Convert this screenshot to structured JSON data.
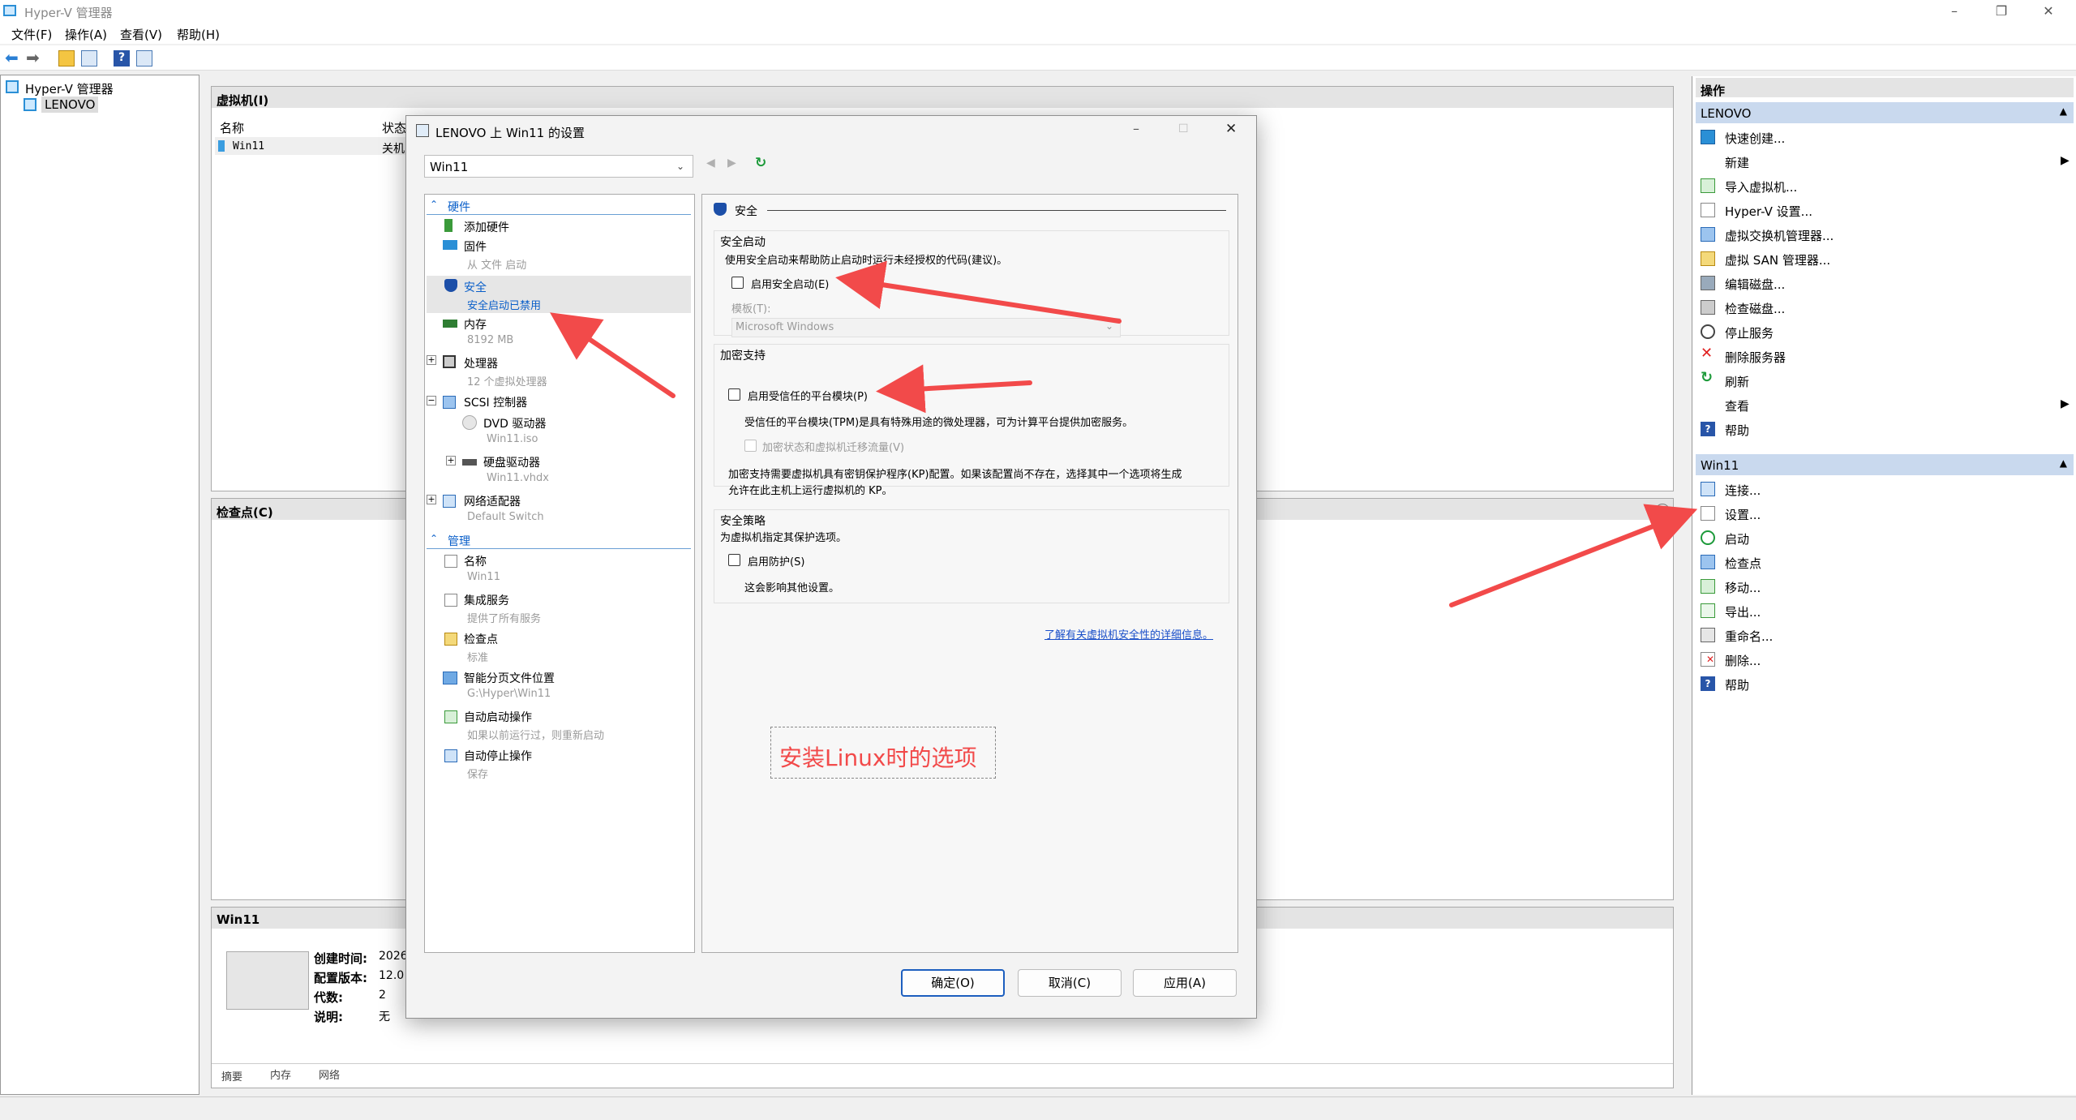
{
  "app": {
    "title": "Hyper-V 管理器"
  },
  "menu": [
    "文件(F)",
    "操作(A)",
    "查看(V)",
    "帮助(H)"
  ],
  "tree": {
    "root": "Hyper-V 管理器",
    "host": "LENOVO"
  },
  "vm_panel": {
    "title": "虚拟机(I)",
    "col_name": "名称",
    "col_state": "状态",
    "row_name": "Win11",
    "row_state": "关机"
  },
  "checkpoint_panel": {
    "title": "检查点(C)"
  },
  "details_panel": {
    "title": "Win11",
    "rows": [
      {
        "label": "创建时间:",
        "value": "2026"
      },
      {
        "label": "配置版本:",
        "value": "12.0"
      },
      {
        "label": "代数:",
        "value": "2"
      },
      {
        "label": "说明:",
        "value": "无"
      }
    ],
    "tabs": [
      "摘要",
      "内存",
      "网络"
    ]
  },
  "actions": {
    "title": "操作",
    "group1": "LENOVO",
    "items1": [
      "快速创建...",
      "新建",
      "导入虚拟机...",
      "Hyper-V 设置...",
      "虚拟交换机管理器...",
      "虚拟 SAN 管理器...",
      "编辑磁盘...",
      "检查磁盘...",
      "停止服务",
      "删除服务器",
      "刷新",
      "查看",
      "帮助"
    ],
    "group2": "Win11",
    "items2": [
      "连接...",
      "设置...",
      "启动",
      "检查点",
      "移动...",
      "导出...",
      "重命名...",
      "删除...",
      "帮助"
    ]
  },
  "dialog": {
    "title": "LENOVO 上 Win11 的设置",
    "vm_select": "Win11",
    "hardware_header": "硬件",
    "hardware": [
      {
        "name": "添加硬件",
        "sub": ""
      },
      {
        "name": "固件",
        "sub": "从 文件 启动"
      },
      {
        "name": "安全",
        "sub": "安全启动已禁用"
      },
      {
        "name": "内存",
        "sub": "8192 MB"
      },
      {
        "name": "处理器",
        "sub": "12 个虚拟处理器"
      },
      {
        "name": "SCSI 控制器",
        "sub": ""
      },
      {
        "name": "DVD 驱动器",
        "sub": "Win11.iso"
      },
      {
        "name": "硬盘驱动器",
        "sub": "Win11.vhdx"
      },
      {
        "name": "网络适配器",
        "sub": "Default Switch"
      }
    ],
    "management_header": "管理",
    "management": [
      {
        "name": "名称",
        "sub": "Win11"
      },
      {
        "name": "集成服务",
        "sub": "提供了所有服务"
      },
      {
        "name": "检查点",
        "sub": "标准"
      },
      {
        "name": "智能分页文件位置",
        "sub": "G:\\Hyper\\Win11"
      },
      {
        "name": "自动启动操作",
        "sub": "如果以前运行过，则重新启动"
      },
      {
        "name": "自动停止操作",
        "sub": "保存"
      }
    ],
    "section_title": "安全",
    "secure_boot": {
      "title": "安全启动",
      "desc": "使用安全启动来帮助防止启动时运行未经授权的代码(建议)。",
      "checkbox": "启用安全启动(E)",
      "template_label": "模板(T):",
      "template_value": "Microsoft Windows"
    },
    "encryption": {
      "title": "加密支持",
      "checkbox": "启用受信任的平台模块(P)",
      "tpm_desc": "受信任的平台模块(TPM)是具有特殊用途的微处理器，可为计算平台提供加密服务。",
      "migrate": "加密状态和虚拟机迁移流量(V)",
      "kp_desc1": "加密支持需要虚拟机具有密钥保护程序(KP)配置。如果该配置尚不存在，选择其中一个选项将生成",
      "kp_desc2": "允许在此主机上运行虚拟机的 KP。"
    },
    "policy": {
      "title": "安全策略",
      "desc": "为虚拟机指定其保护选项。",
      "checkbox": "启用防护(S)",
      "note": "这会影响其他设置。"
    },
    "link": "了解有关虚拟机安全性的详细信息。",
    "annotation": "安装Linux时的选项",
    "buttons": {
      "ok": "确定(O)",
      "cancel": "取消(C)",
      "apply": "应用(A)"
    }
  },
  "colors": {
    "accent": "#0a5fc9",
    "arrow": "#f24a4a",
    "header": "#c9d9ee"
  }
}
